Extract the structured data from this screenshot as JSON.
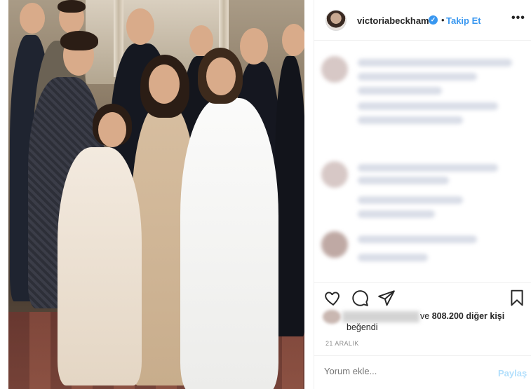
{
  "post": {
    "photo_icon": "group-photo",
    "username": "victoriabeckham",
    "verified_icon": "verified-badge-icon",
    "separator": "•",
    "follow_label": "Takip Et",
    "more_icon": "more-options-icon",
    "more_label": "•••"
  },
  "actions": {
    "like_icon": "heart-icon",
    "comment_icon": "comment-bubble-icon",
    "share_icon": "paper-plane-icon",
    "save_icon": "bookmark-icon"
  },
  "likes": {
    "text_prefix": "ve ",
    "count": "808.200",
    "text_suffix": " diğer kişi",
    "line2": "beğendi"
  },
  "date": "21 ARALIK",
  "add_comment": {
    "placeholder": "Yorum ekle...",
    "post_label": "Paylaş"
  },
  "colors": {
    "accent": "#3897f0",
    "post_disabled": "#b2dffc",
    "text": "#262626",
    "muted": "#8e8e8e"
  }
}
